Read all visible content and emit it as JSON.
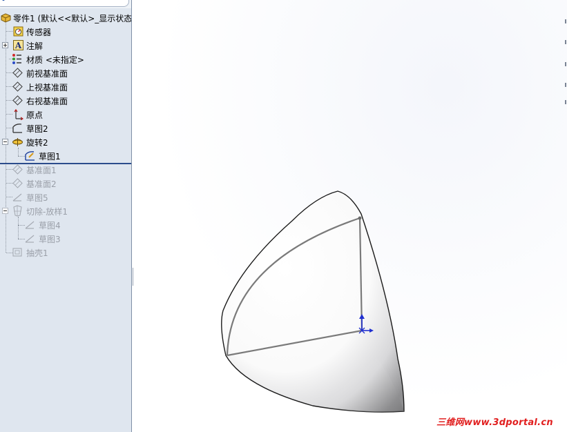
{
  "tree": {
    "filter_icon": "filter-icon",
    "items": [
      {
        "label": "零件1  (默认<<默认>_显示状态",
        "icon": "part-icon"
      },
      {
        "label": "传感器",
        "icon": "sensor-icon"
      },
      {
        "label": "注解",
        "icon": "annotation-icon"
      },
      {
        "label": "材质 <未指定>",
        "icon": "material-icon"
      },
      {
        "label": "前视基准面",
        "icon": "plane-icon"
      },
      {
        "label": "上视基准面",
        "icon": "plane-icon"
      },
      {
        "label": "右视基准面",
        "icon": "plane-icon"
      },
      {
        "label": "原点",
        "icon": "origin-icon"
      },
      {
        "label": "草图2",
        "icon": "sketch-icon"
      },
      {
        "label": "旋转2",
        "icon": "revolve-icon"
      },
      {
        "label": "草图1",
        "icon": "sketch-icon"
      },
      {
        "label": "基准面1",
        "icon": "plane-icon"
      },
      {
        "label": "基准面2",
        "icon": "plane-icon"
      },
      {
        "label": "草图5",
        "icon": "sketch-icon"
      },
      {
        "label": "切除-放样1",
        "icon": "loft-cut-icon"
      },
      {
        "label": "草图4",
        "icon": "sketch-icon"
      },
      {
        "label": "草图3",
        "icon": "sketch-icon"
      },
      {
        "label": "抽壳1",
        "icon": "shell-icon"
      }
    ]
  },
  "graphics": {
    "watermark": "三维网www.3dportal.cn",
    "colors": {
      "panel_bg": "#dfe6ef",
      "rollback_bar": "#2b4c8c",
      "sketch_line": "#808080",
      "triad_blue": "#1f2fd0",
      "watermark": "#e11e1e"
    }
  }
}
